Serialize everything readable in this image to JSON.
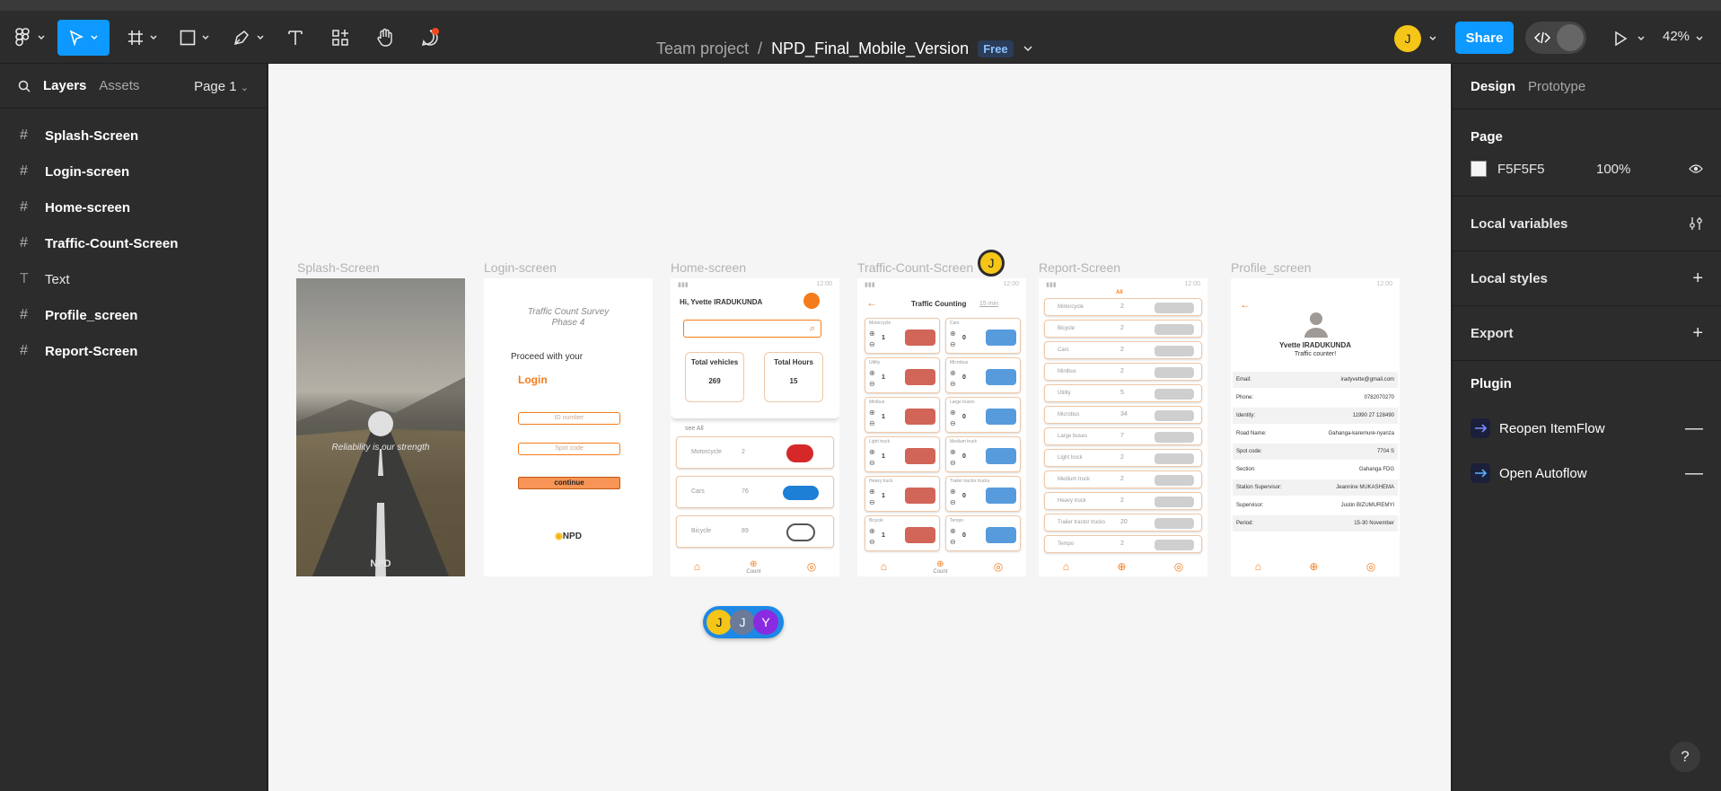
{
  "toolbar": {
    "breadcrumb_team": "Team project",
    "separator": "/",
    "file_name": "NPD_Final_Mobile_Version",
    "plan_badge": "Free",
    "user_initial": "J",
    "share_label": "Share",
    "zoom": "42%"
  },
  "left_panel": {
    "tabs": [
      "Layers",
      "Assets"
    ],
    "page": "Page 1",
    "layers": [
      {
        "name": "Splash-Screen",
        "type": "frame"
      },
      {
        "name": "Login-screen",
        "type": "frame"
      },
      {
        "name": "Home-screen",
        "type": "frame"
      },
      {
        "name": "Traffic-Count-Screen",
        "type": "frame"
      },
      {
        "name": "Text",
        "type": "text"
      },
      {
        "name": "Profile_screen",
        "type": "frame"
      },
      {
        "name": "Report-Screen",
        "type": "frame"
      }
    ]
  },
  "canvas": {
    "frame_labels": [
      "Splash-Screen",
      "Login-screen",
      "Home-screen",
      "Traffic-Count-Screen",
      "Report-Screen",
      "Profile_screen"
    ],
    "splash": {
      "tagline": "Reliability is our strength",
      "logo": "NPD"
    },
    "login": {
      "survey_title": "Traffic Count Survey",
      "survey_phase": "Phase 4",
      "proceed": "Proceed with your",
      "login": "Login",
      "id_placeholder": "ID number",
      "spot_placeholder": "Spot code",
      "continue": "continue",
      "logo": "NPD"
    },
    "home": {
      "time": "12:00",
      "greeting": "Hi, Yvette IRADUKUNDA",
      "total_vehicles_label": "Total vehicles",
      "total_vehicles": "269",
      "total_hours_label": "Total Hours",
      "total_hours": "15",
      "see_all": "see All",
      "rows": [
        {
          "label": "Motorcycle",
          "count": "2"
        },
        {
          "label": "Cars",
          "count": "76"
        },
        {
          "label": "Bicycle",
          "count": "89"
        }
      ],
      "nav_count": "Count"
    },
    "traffic": {
      "time": "12:00",
      "title": "Traffic Counting",
      "interval": "15 min",
      "left_items": [
        "Motorcycle",
        "Utility",
        "Minibus",
        "Light truck",
        "Heavy truck",
        "Bicycle"
      ],
      "left_counts": [
        "1",
        "1",
        "1",
        "1",
        "1",
        "1"
      ],
      "right_items": [
        "Cars",
        "Microbus",
        "Large buses",
        "Medium truck",
        "Trailer tractor trucks",
        "Tempo"
      ],
      "right_counts": [
        "0",
        "0",
        "0",
        "0",
        "0",
        "0"
      ],
      "nav_count": "Count"
    },
    "report": {
      "time": "12:00",
      "filter": "All",
      "rows": [
        {
          "label": "Motorcycle",
          "count": "2"
        },
        {
          "label": "Bicycle",
          "count": "2"
        },
        {
          "label": "Cars",
          "count": "2"
        },
        {
          "label": "Minibus",
          "count": "2"
        },
        {
          "label": "Utility",
          "count": "5"
        },
        {
          "label": "Microbus",
          "count": "34"
        },
        {
          "label": "Large buses",
          "count": "7"
        },
        {
          "label": "Light truck",
          "count": "2"
        },
        {
          "label": "Medium truck",
          "count": "2"
        },
        {
          "label": "Heavy truck",
          "count": "2"
        },
        {
          "label": "Trailer tractor trucks",
          "count": "20"
        },
        {
          "label": "Tempo",
          "count": "2"
        }
      ]
    },
    "profile": {
      "time": "12:00",
      "name": "Yvette IRADUKUNDA",
      "role": "Traffic counter!",
      "fields": [
        {
          "label": "Email:",
          "value": "iradyvette@gmail.com"
        },
        {
          "label": "Phone:",
          "value": "0782070270"
        },
        {
          "label": "Identity:",
          "value": "11990 27 128490"
        },
        {
          "label": "Road Name:",
          "value": "Gahanga-karemure-nyanza"
        },
        {
          "label": "Spot code:",
          "value": "7704 S"
        },
        {
          "label": "Section:",
          "value": "Gahanga FDG"
        },
        {
          "label": "Station Supervisor:",
          "value": "Jeannine MUKASHEMA"
        },
        {
          "label": "Supervisor:",
          "value": "Justin BIZUMUREMYI"
        },
        {
          "label": "Period:",
          "value": "15-30 November"
        }
      ]
    },
    "comment_marker_initial": "J",
    "presence": [
      "J",
      "J",
      "Y"
    ]
  },
  "right_panel": {
    "tabs": [
      "Design",
      "Prototype"
    ],
    "page_title": "Page",
    "page_color": "F5F5F5",
    "page_opacity": "100%",
    "local_variables": "Local variables",
    "local_styles": "Local styles",
    "export": "Export",
    "plugin_title": "Plugin",
    "plugins": [
      "Reopen ItemFlow",
      "Open Autoflow"
    ],
    "help": "?"
  },
  "colors": {
    "accent": "#0d99ff",
    "app_orange": "#f47c1c",
    "canvas_bg": "#f5f5f5",
    "panel_bg": "#2c2c2c"
  }
}
